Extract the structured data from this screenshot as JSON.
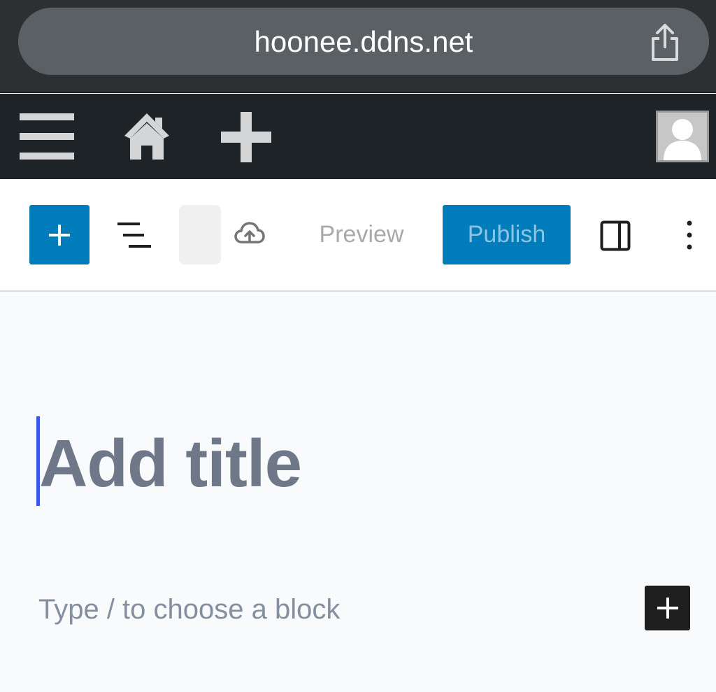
{
  "browser": {
    "url": "hoonee.ddns.net",
    "share_icon": "share-icon"
  },
  "admin_bar": {
    "icons": [
      "menu-icon",
      "home-icon",
      "plus-icon",
      "avatar"
    ]
  },
  "toolbar": {
    "inserter_icon": "plus-icon",
    "outline_icon": "document-outline-icon",
    "save_icon": "cloud-upload-icon",
    "preview_label": "Preview",
    "publish_label": "Publish",
    "settings_icon": "sidebar-toggle-icon",
    "more_icon": "more-vertical-icon",
    "accent_color": "#007cba"
  },
  "editor": {
    "title_placeholder": "Add title",
    "block_placeholder": "Type / to choose a block",
    "caret_color": "#3858e9"
  }
}
